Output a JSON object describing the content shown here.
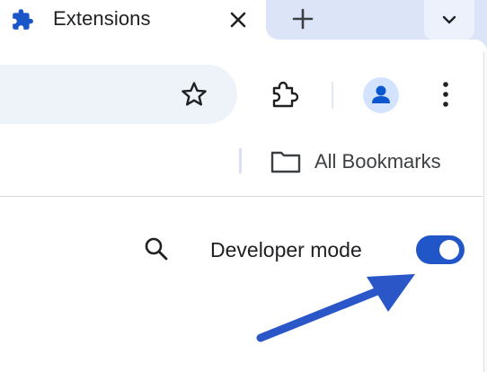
{
  "tab": {
    "title": "Extensions",
    "favicon": "puzzle-piece-icon",
    "close": "close-icon"
  },
  "tabstrip": {
    "new_tab": "plus-icon",
    "tab_search": "chevron-down-icon"
  },
  "toolbar": {
    "bookmark_star": "star-icon",
    "extensions": "puzzle-outline-icon",
    "profile": "person-avatar-icon",
    "menu": "three-dot-menu-icon"
  },
  "bookmarks_bar": {
    "folder_icon": "folder-icon",
    "label": "All Bookmarks"
  },
  "content": {
    "search": "search-icon",
    "developer_mode_label": "Developer mode",
    "developer_mode_on": true,
    "annotation": "blue-arrow"
  },
  "colors": {
    "accent": "#2156c9",
    "tabstrip": "#dce5f8",
    "omnibox": "#eef2f9",
    "arrow": "#2a56c8"
  }
}
